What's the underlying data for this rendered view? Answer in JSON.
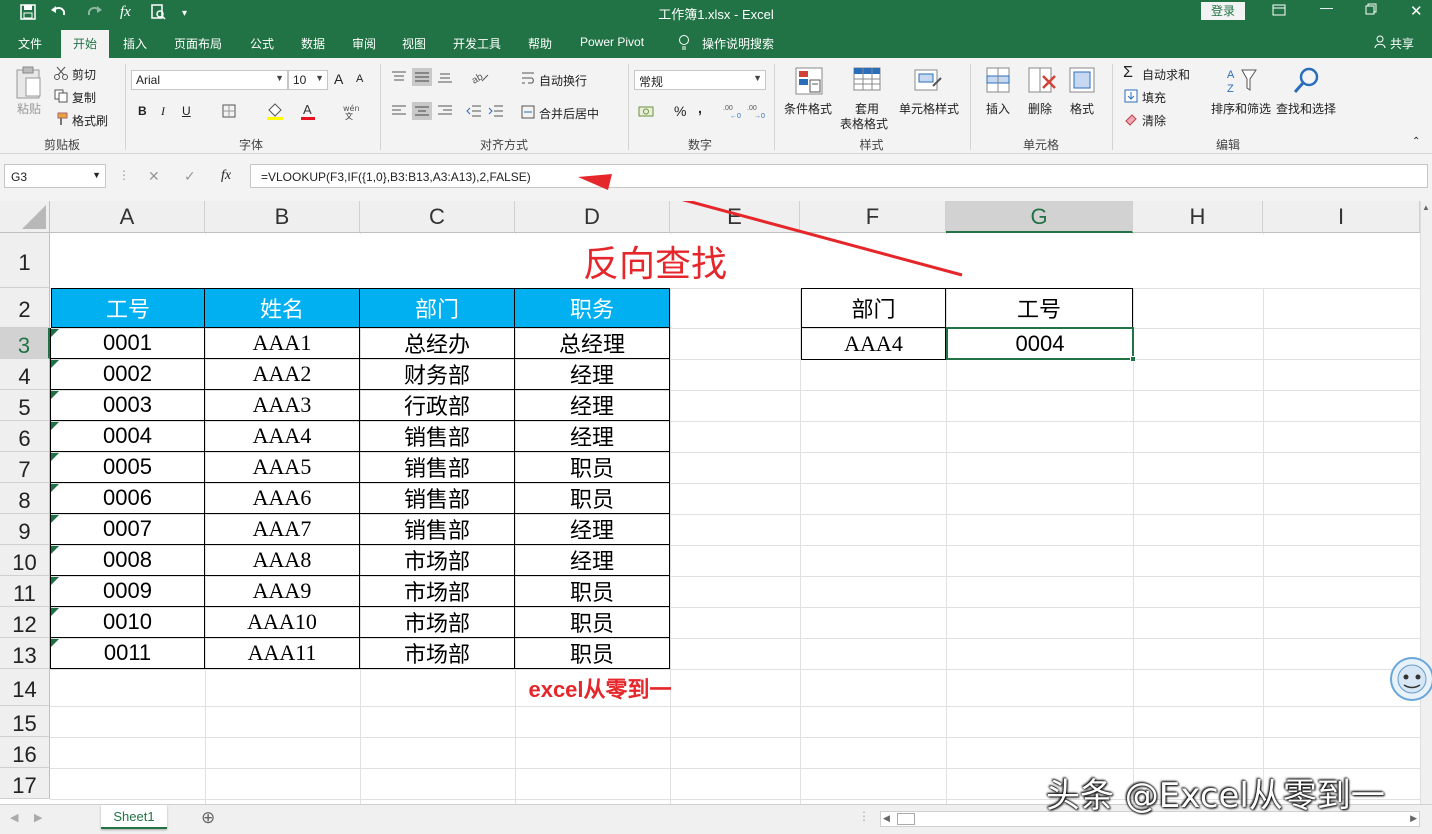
{
  "window": {
    "title": "工作簿1.xlsx  -  Excel",
    "login": "登录",
    "qa_icons": [
      "save-icon",
      "undo-icon",
      "redo-icon",
      "fx-icon",
      "print-preview-icon",
      "customize-icon"
    ]
  },
  "tabs": [
    "文件",
    "开始",
    "插入",
    "页面布局",
    "公式",
    "数据",
    "审阅",
    "视图",
    "开发工具",
    "帮助",
    "Power Pivot"
  ],
  "tell_me": "操作说明搜索",
  "share": "共享",
  "ribbon": {
    "clipboard": {
      "paste": "粘贴",
      "cut": "剪切",
      "copy": "复制",
      "format_painter": "格式刷",
      "label": "剪贴板"
    },
    "font": {
      "name": "Arial",
      "size": "10",
      "bold": "B",
      "italic": "I",
      "underline": "U",
      "grow": "A",
      "shrink": "A",
      "label": "字体"
    },
    "alignment": {
      "wrap": "自动换行",
      "merge": "合并后居中",
      "label": "对齐方式"
    },
    "number": {
      "format": "常规",
      "percent": "%",
      "comma": ",",
      "label": "数字"
    },
    "styles": {
      "cond": "条件格式",
      "table1": "套用",
      "table2": "表格格式",
      "cell_styles": "单元格样式",
      "label": "样式"
    },
    "cells": {
      "insert": "插入",
      "delete": "删除",
      "format": "格式",
      "label": "单元格"
    },
    "editing": {
      "autosum": "自动求和",
      "fill": "填充",
      "clear": "清除",
      "sort": "排序和筛选",
      "find": "查找和选择",
      "label": "编辑"
    }
  },
  "namebox": "G3",
  "formula": "=VLOOKUP(F3,IF({1,0},B3:B13,A3:A13),2,FALSE)",
  "colors": {
    "accent": "#217346",
    "header_fill": "#00b0f0",
    "arrow": "#e5262a",
    "title": "#e5262a"
  },
  "columns": [
    "A",
    "B",
    "C",
    "D",
    "E",
    "F",
    "G",
    "H",
    "I"
  ],
  "rows": [
    "1",
    "2",
    "3",
    "4",
    "5",
    "6",
    "7",
    "8",
    "9",
    "10",
    "11",
    "12",
    "13",
    "14",
    "15",
    "16",
    "17"
  ],
  "sheet": {
    "title": "反向查找",
    "headers": [
      "工号",
      "姓名",
      "部门",
      "职务"
    ],
    "data": [
      [
        "0001",
        "AAA1",
        "总经办",
        "总经理"
      ],
      [
        "0002",
        "AAA2",
        "财务部",
        "经理"
      ],
      [
        "0003",
        "AAA3",
        "行政部",
        "经理"
      ],
      [
        "0004",
        "AAA4",
        "销售部",
        "经理"
      ],
      [
        "0005",
        "AAA5",
        "销售部",
        "职员"
      ],
      [
        "0006",
        "AAA6",
        "销售部",
        "职员"
      ],
      [
        "0007",
        "AAA7",
        "销售部",
        "经理"
      ],
      [
        "0008",
        "AAA8",
        "市场部",
        "经理"
      ],
      [
        "0009",
        "AAA9",
        "市场部",
        "职员"
      ],
      [
        "0010",
        "AAA10",
        "市场部",
        "职员"
      ],
      [
        "0011",
        "AAA11",
        "市场部",
        "职员"
      ]
    ],
    "lookup_headers": [
      "部门",
      "工号"
    ],
    "lookup_values": [
      "AAA4",
      "0004"
    ],
    "credit": "excel从零到一"
  },
  "sheet_tab": "Sheet1",
  "watermark": "头条 @Excel从零到一"
}
